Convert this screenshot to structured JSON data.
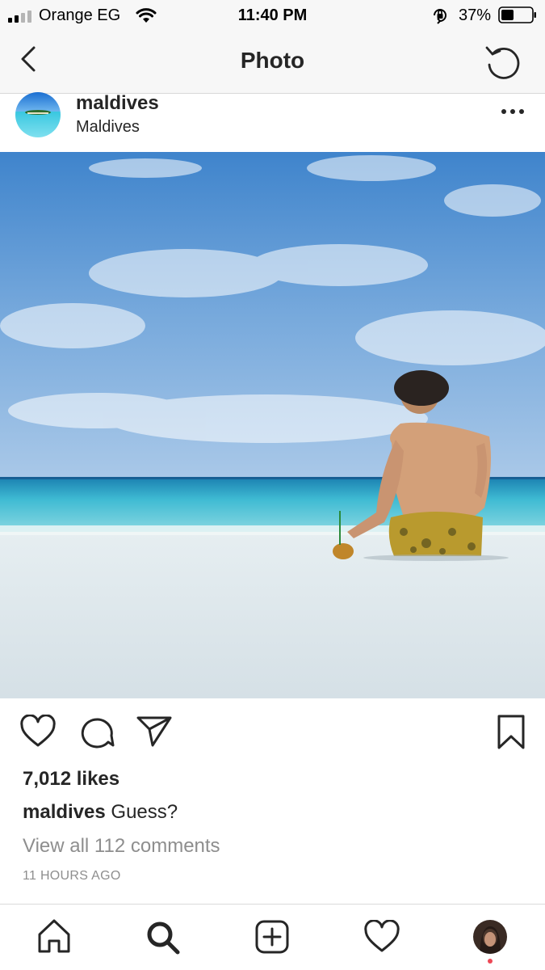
{
  "status_bar": {
    "carrier": "Orange EG",
    "time": "11:40 PM",
    "battery": "37%"
  },
  "nav": {
    "title": "Photo",
    "back_icon": "chevron-left-icon",
    "refresh_icon": "refresh-icon"
  },
  "post": {
    "username": "maldives",
    "location": "Maldives",
    "more_icon": "more-horizontal-icon",
    "likes": "7,012 likes",
    "caption_user": "maldives",
    "caption_text": " Guess?",
    "view_comments": "View all 112 comments",
    "time_ago": "11 HOURS AGO"
  },
  "actions": [
    "heart-icon",
    "comment-icon",
    "share-icon",
    "bookmark-icon"
  ],
  "tab_bar": [
    "home-icon",
    "search-icon",
    "new-post-icon",
    "activity-icon",
    "profile-avatar"
  ],
  "colors": {
    "text": "#262626",
    "secondary_text": "#8e8e8e",
    "notification_dot": "#ed4956",
    "bar_background": "#f7f7f7"
  }
}
